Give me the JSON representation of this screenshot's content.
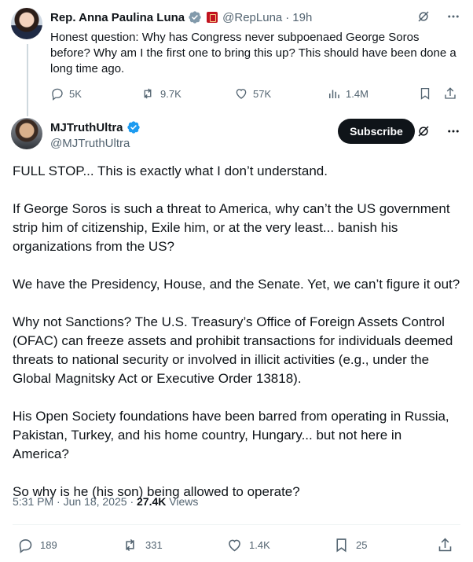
{
  "parent_tweet": {
    "author_name": "Rep. Anna Paulina Luna",
    "handle": "@RepLuna",
    "separator": "·",
    "time": "19h",
    "text": "Honest question: Why has Congress never subpoenaed George Soros before? Why am I the first one to bring this up? This should have been done a long time ago.",
    "stats": {
      "replies": "5K",
      "reposts": "9.7K",
      "likes": "57K",
      "views": "1.4M"
    }
  },
  "main_tweet": {
    "author_name": "MJTruthUltra",
    "handle": "@MJTruthUltra",
    "subscribe_label": "Subscribe",
    "paragraphs": [
      "FULL STOP... This is exactly what I don’t understand.",
      "If George Soros is such a threat to America, why can’t the US government strip him of citizenship, Exile him, or at the very least... banish his organizations from the US?",
      "We have the Presidency, House, and the Senate. Yet, we can’t figure it out?",
      "Why not Sanctions? The U.S. Treasury’s Office of Foreign Assets Control (OFAC) can freeze assets and prohibit transactions for individuals deemed threats to national security or involved in illicit activities (e.g., under the Global Magnitsky Act or Executive Order 13818).",
      "His Open Society foundations have been barred from operating in Russia, Pakistan, Turkey, and his home country, Hungary... but not here in America?",
      "So why is he (his son) being allowed to operate?"
    ],
    "time": "5:31 PM",
    "date_separator": "·",
    "date": "Jun 18, 2025",
    "views_separator": "·",
    "views_count": "27.4K",
    "views_label": "Views",
    "stats": {
      "replies": "189",
      "reposts": "331",
      "likes": "1.4K",
      "bookmarks": "25"
    }
  },
  "icons": {
    "verified_blue": "#1d9bf0",
    "verified_grey": "#829aab",
    "muted": "#536471"
  }
}
